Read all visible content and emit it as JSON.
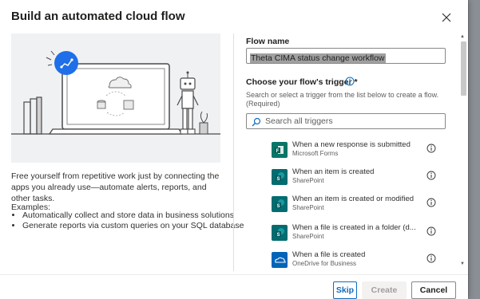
{
  "dialog": {
    "title": "Build an automated cloud flow",
    "description": "Free yourself from repetitive work just by connecting the apps you already use—automate alerts, reports, and other tasks.",
    "examples_heading": "Examples:",
    "examples": [
      "Automatically collect and store data in business solutions",
      "Generate reports via custom queries on your SQL database"
    ]
  },
  "form": {
    "flow_name_label": "Flow name",
    "flow_name_value": "Theta CIMA status change workflow",
    "trigger_label": "Choose your flow's trigger *",
    "trigger_hint": "Search or select a trigger from the list below to create a flow. (Required)",
    "search_placeholder": "Search all triggers"
  },
  "triggers": [
    {
      "name": "When a new response is submitted",
      "connector": "Microsoft Forms",
      "icon": "forms-icon",
      "color": "#077568"
    },
    {
      "name": "When an item is created",
      "connector": "SharePoint",
      "icon": "sharepoint-icon",
      "color": "#036c70"
    },
    {
      "name": "When an item is created or modified",
      "connector": "SharePoint",
      "icon": "sharepoint-icon",
      "color": "#036c70"
    },
    {
      "name": "When a file is created in a folder (d...",
      "connector": "SharePoint",
      "icon": "sharepoint-icon",
      "color": "#036c70"
    },
    {
      "name": "When a file is created",
      "connector": "OneDrive for Business",
      "icon": "onedrive-icon",
      "color": "#0364b8"
    }
  ],
  "buttons": {
    "skip": "Skip",
    "create": "Create",
    "cancel": "Cancel"
  },
  "colors": {
    "accent": "#0f6cbd",
    "illustration_badge": "#1e6fe8"
  }
}
